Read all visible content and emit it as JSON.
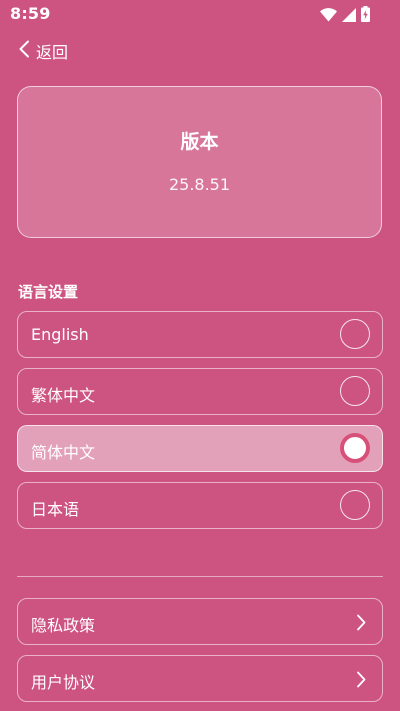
{
  "status_bar": {
    "time": "8:59",
    "icons": [
      "wifi-icon",
      "cellular-signal-icon",
      "battery-charging-icon"
    ]
  },
  "header": {
    "back_label": "返回",
    "back_icon": "chevron-left-icon"
  },
  "version_card": {
    "title": "版本",
    "version": "25.8.51"
  },
  "language_section": {
    "title": "语言设置",
    "options": [
      {
        "label": "English",
        "selected": false
      },
      {
        "label": "繁体中文",
        "selected": false
      },
      {
        "label": "简体中文",
        "selected": true
      },
      {
        "label": "日本语",
        "selected": false
      }
    ]
  },
  "links": [
    {
      "label": "隐私政策",
      "icon": "chevron-right-icon"
    },
    {
      "label": "用户协议",
      "icon": "chevron-right-icon"
    }
  ],
  "colors": {
    "background": "#cd5480",
    "radio_selected_ring": "#d8507a"
  }
}
